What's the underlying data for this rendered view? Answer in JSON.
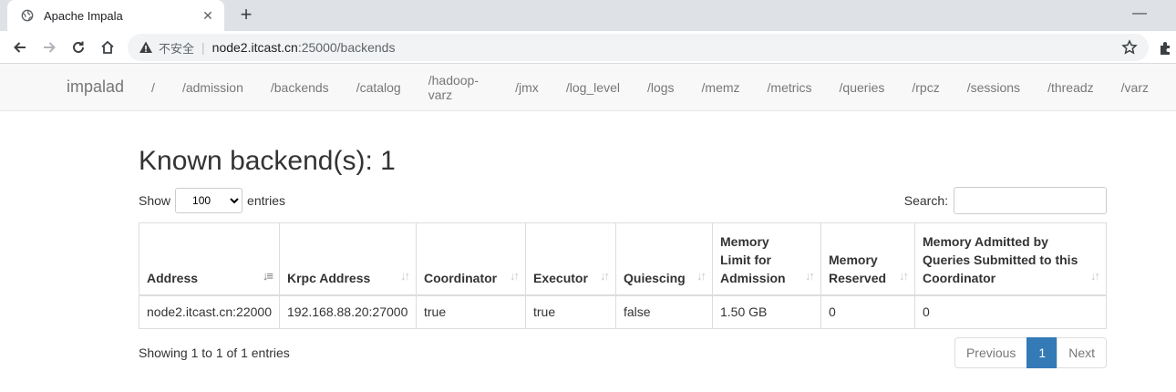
{
  "browser": {
    "tab_title": "Apache Impala",
    "insecure_label": "不安全",
    "url_host": "node2.itcast.cn",
    "url_path": ":25000/backends"
  },
  "nav": {
    "brand": "impalad",
    "links": [
      "/",
      "/admission",
      "/backends",
      "/catalog",
      "/hadoop-varz",
      "/jmx",
      "/log_level",
      "/logs",
      "/memz",
      "/metrics",
      "/queries",
      "/rpcz",
      "/sessions",
      "/threadz",
      "/varz"
    ]
  },
  "page": {
    "title": "Known backend(s): 1",
    "show_label": "Show",
    "entries_label": "entries",
    "page_length": "100",
    "search_label": "Search:",
    "search_value": ""
  },
  "table": {
    "headers": [
      "Address",
      "Krpc Address",
      "Coordinator",
      "Executor",
      "Quiescing",
      "Memory Limit for Admission",
      "Memory Reserved",
      "Memory Admitted by Queries Submitted to this Coordinator"
    ],
    "rows": [
      [
        "node2.itcast.cn:22000",
        "192.168.88.20:27000",
        "true",
        "true",
        "false",
        "1.50 GB",
        "0",
        "0"
      ]
    ]
  },
  "footer": {
    "info": "Showing 1 to 1 of 1 entries",
    "previous": "Previous",
    "current_page": "1",
    "next": "Next"
  }
}
